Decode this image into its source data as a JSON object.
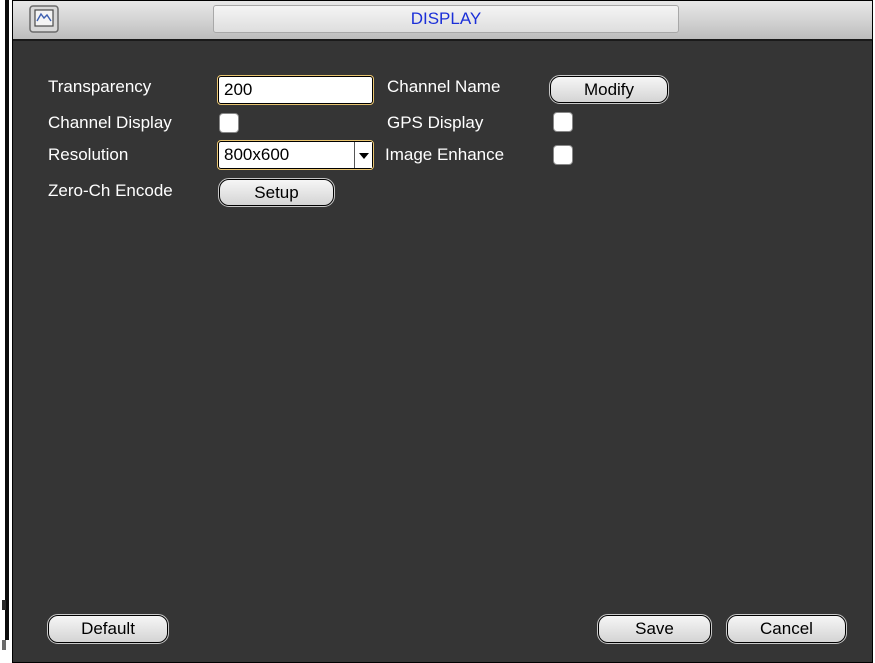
{
  "window": {
    "title": "DISPLAY",
    "icon": "window-app-icon"
  },
  "form": {
    "transparency": {
      "label": "Transparency",
      "value": "200"
    },
    "channel_name": {
      "label": "Channel Name",
      "button": "Modify"
    },
    "channel_display": {
      "label": "Channel Display",
      "checked": false
    },
    "gps_display": {
      "label": "GPS Display",
      "checked": false
    },
    "resolution": {
      "label": "Resolution",
      "value": "800x600"
    },
    "image_enhance": {
      "label": "Image Enhance",
      "checked": false
    },
    "zero_ch_encode": {
      "label": "Zero-Ch Encode",
      "button": "Setup"
    }
  },
  "footer": {
    "default_label": "Default",
    "save_label": "Save",
    "cancel_label": "Cancel"
  },
  "colors": {
    "panel_bg": "#353535",
    "title_text": "#1b2fd8",
    "label_text": "#ffffff"
  }
}
